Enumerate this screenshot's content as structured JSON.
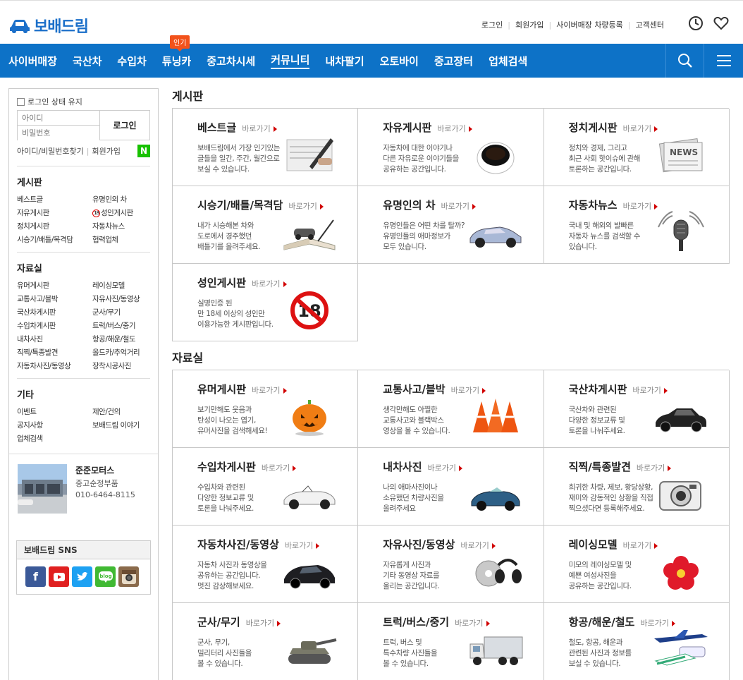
{
  "header": {
    "logo_text": "보배드림",
    "util_links": [
      "로그인",
      "회원가입",
      "사이버매장 차량등록",
      "고객센터"
    ]
  },
  "nav": {
    "items": [
      "사이버매장",
      "국산차",
      "수입차",
      "튜닝카",
      "중고차시세",
      "커뮤니티",
      "내차팔기",
      "오토바이",
      "중고장터",
      "업체검색"
    ],
    "hot_badge": "인기",
    "active": "커뮤니티"
  },
  "sidebar": {
    "keep_login": "로그인 상태 유지",
    "id_placeholder": "아이디",
    "pw_placeholder": "비밀번호",
    "login_btn": "로그인",
    "find_link": "아이디/비밀번호찾기",
    "join_link": "회원가입",
    "naver": "N",
    "sections": [
      {
        "title": "게시판",
        "items": [
          "베스트글",
          "유명인의 차",
          "자유게시판",
          "성인게시판",
          "정치게시판",
          "자동차뉴스",
          "시승기/배틀/목격담",
          "협력업체"
        ]
      },
      {
        "title": "자료실",
        "items": [
          "유머게시판",
          "레이싱모델",
          "교통사고/블박",
          "자유사진/동영상",
          "국산차게시판",
          "군사/무기",
          "수입차게시판",
          "트럭/버스/중기",
          "내차사진",
          "항공/해운/철도",
          "직찍/특종발견",
          "올드카/추억거리",
          "자동차사진/동영상",
          "장착시공사진"
        ]
      },
      {
        "title": "기타",
        "items": [
          "이벤트",
          "제안/건의",
          "공지사항",
          "보배드림 이야기",
          "업체검색",
          ""
        ]
      }
    ],
    "n18": "18",
    "shop": {
      "name": "준준모터스",
      "type": "중고순정부품",
      "phone": "010-6464-8115"
    },
    "sns_title": "보배드림 SNS"
  },
  "main": {
    "go_label": "바로가기",
    "board_title": "게시판",
    "boards": [
      {
        "title": "베스트글",
        "desc": "보배드림에서 가장 인기있는\n글들을 일간, 주간, 월간으로\n보실 수 있습니다.",
        "icon": "pen-icon"
      },
      {
        "title": "자유게시판",
        "desc": "자동차에 대한 이야기나\n다른 자유로운 이야기들을\n공유하는 공간입니다.",
        "icon": "coffee-icon"
      },
      {
        "title": "정치게시판",
        "desc": "정치와 경제, 그리고\n최근 사회 핫이슈에 관해\n토론하는 공간입니다.",
        "icon": "newspaper-icon"
      },
      {
        "title": "시승기/배틀/목격담",
        "desc": "내가 시승해본 차와\n도로에서 경주했던\n배틀기를 올려주세요.",
        "icon": "book-icon"
      },
      {
        "title": "유명인의 차",
        "desc": "유명인들은 어떤 차를 탈까?\n유명인들의 애마정보가\n모두 있습니다.",
        "icon": "sportscar-icon"
      },
      {
        "title": "자동차뉴스",
        "desc": "국내 및 해외의 발빠른\n자동차 뉴스를 검색할 수\n있습니다.",
        "icon": "microphone-icon"
      },
      {
        "title": "성인게시판",
        "desc": "실명인증 된\n만 18세 이상의 성인만\n이용가능한 게시판입니다.",
        "icon": "adult-18-icon"
      }
    ],
    "data_title": "자료실",
    "data": [
      {
        "title": "유머게시판",
        "desc": "보기만해도 웃음과\n탄성이 나오는 엽기,\n유머사진을 검색해세요!",
        "icon": "pumpkin-icon"
      },
      {
        "title": "교통사고/블박",
        "desc": "생각만해도 아찔한\n교통사고와 블랙박스\n영상을 볼 수 있습니다.",
        "icon": "traffic-cone-icon"
      },
      {
        "title": "국산차게시판",
        "desc": "국산차와 관련된\n다양한 정보교류 및\n토론을 나눠주세요.",
        "icon": "sedan-icon"
      },
      {
        "title": "수입차게시판",
        "desc": "수입차와 관련된\n다양한 정보교류 및\n토론을 나눠주세요.",
        "icon": "convertible-icon"
      },
      {
        "title": "내차사진",
        "desc": "나의 애마사진이나\n소유했던 차량사진을\n올려주세요",
        "icon": "roadster-icon"
      },
      {
        "title": "직찍/특종발견",
        "desc": "희귀한 차량, 제보, 황당상황,\n재미와 감동적인 상황을 직접\n찍으셨다면 등록해주세요.",
        "icon": "camera-icon"
      },
      {
        "title": "자동차사진/동영상",
        "desc": "자동차 사진과 동영상을\n공유하는 공간입니다.\n멋진 감상해보세요.",
        "icon": "car-photo-icon"
      },
      {
        "title": "자유사진/동영상",
        "desc": "자유롭게 사진과\n기타 동영상 자료를\n올리는 공간입니다.",
        "icon": "headphones-icon"
      },
      {
        "title": "레이싱모델",
        "desc": "미모의 레이싱모델 및\n예쁜 여성사진을\n공유하는 공간입니다.",
        "icon": "flower-icon"
      },
      {
        "title": "군사/무기",
        "desc": "군사, 무기,\n밀리터리 사진들을\n볼 수 있습니다.",
        "icon": "tank-icon"
      },
      {
        "title": "트럭/버스/중기",
        "desc": "트럭, 버스 및\n특수차량 사진들을\n볼 수 있습니다.",
        "icon": "truck-icon"
      },
      {
        "title": "항공/해운/철도",
        "desc": "철도, 항공, 해운과\n관련된 사진과 정보를\n보실 수 있습니다.",
        "icon": "airplane-icon"
      }
    ]
  },
  "colors": {
    "brand": "#0d72c7",
    "hot": "#f2521b",
    "arrow": "#d10000",
    "naver": "#18c100"
  }
}
